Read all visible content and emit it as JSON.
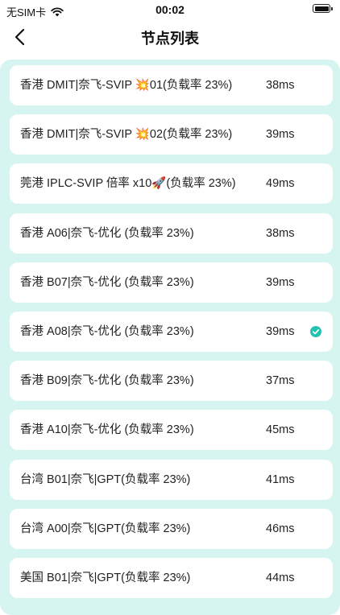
{
  "status_bar": {
    "carrier": "无SIM卡",
    "time": "00:02"
  },
  "nav": {
    "title": "节点列表",
    "back_icon": "chevron-left-icon"
  },
  "colors": {
    "panel_bg": "#d6f5f0",
    "check": "#26c2b1"
  },
  "nodes": [
    {
      "name": "香港 DMIT|奈飞-SVIP 💥01(负载率 23%)",
      "latency": "38ms",
      "selected": false
    },
    {
      "name": "香港 DMIT|奈飞-SVIP 💥02(负载率 23%)",
      "latency": "39ms",
      "selected": false
    },
    {
      "name": "莞港 IPLC-SVIP 倍率 x10🚀(负载率 23%)",
      "latency": "49ms",
      "selected": false
    },
    {
      "name": "香港 A06|奈飞-优化 (负载率 23%)",
      "latency": "38ms",
      "selected": false
    },
    {
      "name": "香港 B07|奈飞-优化 (负载率 23%)",
      "latency": "39ms",
      "selected": false
    },
    {
      "name": "香港 A08|奈飞-优化 (负载率 23%)",
      "latency": "39ms",
      "selected": true
    },
    {
      "name": "香港 B09|奈飞-优化 (负载率 23%)",
      "latency": "37ms",
      "selected": false
    },
    {
      "name": "香港 A10|奈飞-优化 (负载率 23%)",
      "latency": "45ms",
      "selected": false
    },
    {
      "name": "台湾 B01|奈飞|GPT(负载率 23%)",
      "latency": "41ms",
      "selected": false
    },
    {
      "name": "台湾 A00|奈飞|GPT(负载率 23%)",
      "latency": "46ms",
      "selected": false
    },
    {
      "name": "美国 B01|奈飞|GPT(负载率 23%)",
      "latency": "44ms",
      "selected": false
    }
  ]
}
